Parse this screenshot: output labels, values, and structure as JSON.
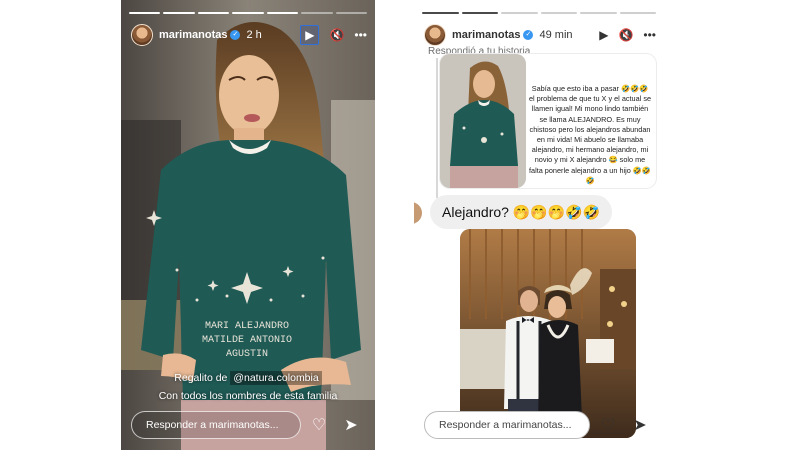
{
  "story_left": {
    "username": "marimanotas",
    "time": "2 h",
    "progress_segments": 7,
    "active_segment": 5,
    "caption_prefix": "Regalito de ",
    "mention": "@natura.colombia",
    "caption_line2": "Con todos los nombres de esta familia",
    "sweater_text": [
      "MARI ALEJANDRO",
      "MATILDE ANTONIO",
      "AGUSTIN"
    ],
    "reply_placeholder": "Responder a marimanotas...",
    "icons": {
      "play": "play-icon",
      "mute": "mute-icon",
      "more": "more-icon",
      "heart": "heart-icon",
      "send": "send-icon",
      "verified": "verified-badge-icon"
    }
  },
  "story_right": {
    "username": "marimanotas",
    "time": "49 min",
    "progress_segments": 6,
    "active_segment": 2,
    "replied_label": "Respondió a tu historia",
    "quoted_message": "Sabía que esto iba a pasar 🤣🤣🤣 el problema de que tu X y el actual se llamen igual! Mi mono lindo también se llama ALEJANDRO. Es muy chistoso pero los alejandros abundan en mi vida! Mi abuelo se llamaba alejandro, mi hermano alejandro, mi novio y mi X alejandro 😂 solo me falta ponerle alejandro a un hijo 🤣🤣🤣",
    "reply_bubble": "Alejandro? 🤭🤭🤭🤣🤣",
    "reply_placeholder": "Responder a marimanotas...",
    "icons": {
      "play": "play-icon",
      "mute": "mute-icon",
      "more": "more-icon",
      "heart": "heart-icon",
      "send": "send-icon",
      "verified": "verified-badge-icon"
    }
  },
  "colors": {
    "sweater": "#1f5a55",
    "verified": "#3897f0",
    "play_highlight": "#2f6fdc",
    "background": "#ffffff"
  }
}
